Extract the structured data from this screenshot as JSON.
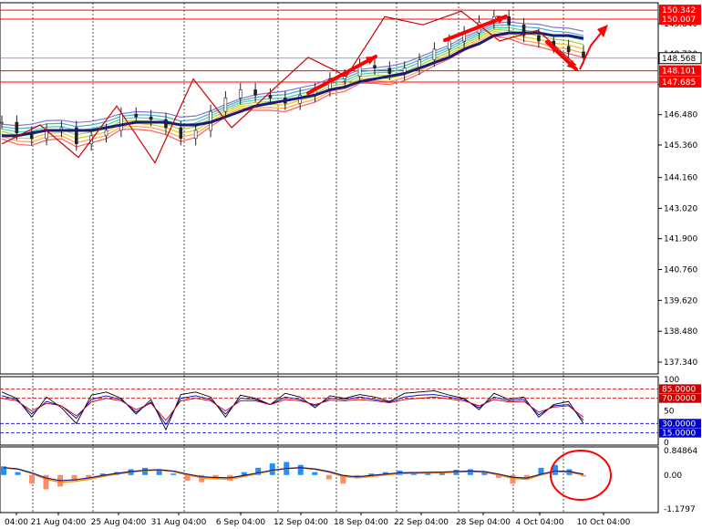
{
  "chart_data": [
    {
      "type": "line",
      "title": "",
      "price_axis_ticks": [
        "149.840",
        "148.720",
        "147.600",
        "146.480",
        "145.360",
        "144.160",
        "143.020",
        "141.900",
        "140.760",
        "139.620",
        "138.480",
        "137.340"
      ],
      "price_levels": [
        {
          "value": "150.342",
          "color": "#ff0000",
          "label_style": "box"
        },
        {
          "value": "150.007",
          "color": "#ff0000",
          "label_style": "box"
        },
        {
          "value": "148.568",
          "color": "#000000",
          "label_style": "current"
        },
        {
          "value": "148.101",
          "color": "#ff0000",
          "label_style": "box"
        },
        {
          "value": "147.685",
          "color": "#ff0000",
          "label_style": "box"
        }
      ],
      "x_axis_labels": [
        "04:00",
        "21 Aug 04:00",
        "25 Aug 04:00",
        "31 Aug 04:00",
        "6 Sep 04:00",
        "12 Sep 04:00",
        "18 Sep 04:00",
        "22 Sep 04:00",
        "28 Sep 04:00",
        "4 Oct 04:00",
        "10 Oct 04:00"
      ],
      "zigzag_path": [
        145.4,
        146.1,
        144.9,
        146.8,
        144.7,
        147.8,
        146.0,
        147.3,
        148.6,
        147.9,
        150.1,
        149.8,
        150.3,
        149.2,
        149.6,
        148.3
      ],
      "price_series": [
        146.2,
        145.8,
        145.6,
        145.9,
        146.0,
        145.4,
        145.7,
        145.9,
        146.5,
        146.4,
        146.3,
        146.0,
        145.6,
        145.9,
        146.6,
        147.1,
        147.4,
        147.2,
        147.1,
        146.9,
        147.2,
        147.4,
        147.8,
        147.9,
        148.3,
        148.2,
        148.0,
        148.2,
        148.5,
        148.9,
        149.2,
        149.5,
        149.9,
        150.1,
        149.8,
        149.4,
        149.2,
        149.0,
        148.8,
        148.6
      ],
      "ma_series": [
        145.7,
        145.7,
        145.8,
        145.9,
        145.9,
        145.9,
        145.9,
        146.0,
        146.1,
        146.2,
        146.2,
        146.2,
        146.1,
        146.1,
        146.2,
        146.4,
        146.6,
        146.8,
        146.9,
        147.0,
        147.1,
        147.2,
        147.4,
        147.5,
        147.7,
        147.8,
        147.9,
        148.0,
        148.2,
        148.4,
        148.6,
        148.9,
        149.1,
        149.4,
        149.5,
        149.5,
        149.5,
        149.4,
        149.4,
        149.3
      ],
      "colors": {
        "zigzag": "#cc0000",
        "ma": "#1a1a7a",
        "arrows": "#ff0000",
        "level": "#ff0000"
      }
    },
    {
      "type": "line",
      "title": "",
      "axis_ticks": [
        "100",
        "50",
        "0"
      ],
      "ylim": [
        0,
        100
      ],
      "levels": [
        {
          "value": "85.0000",
          "color": "#cc0000"
        },
        {
          "value": "70.0000",
          "color": "#cc0000"
        },
        {
          "value": "30.0000",
          "color": "#0000cc"
        },
        {
          "value": "15.0000",
          "color": "#0000cc"
        }
      ],
      "series": [
        {
          "values": [
            80,
            70,
            40,
            72,
            55,
            30,
            75,
            80,
            70,
            45,
            68,
            20,
            76,
            80,
            72,
            40,
            75,
            70,
            60,
            78,
            72,
            55,
            74,
            70,
            76,
            72,
            65,
            78,
            80,
            82,
            75,
            70,
            52,
            78,
            68,
            72,
            40,
            60,
            65,
            30
          ]
        },
        {
          "values": [
            74,
            68,
            45,
            65,
            58,
            38,
            68,
            74,
            68,
            48,
            64,
            28,
            70,
            74,
            68,
            45,
            70,
            68,
            60,
            72,
            68,
            58,
            70,
            68,
            72,
            68,
            64,
            72,
            75,
            76,
            72,
            68,
            55,
            72,
            66,
            68,
            44,
            58,
            60,
            35
          ]
        },
        {
          "values": [
            70,
            66,
            50,
            62,
            58,
            42,
            64,
            70,
            66,
            52,
            62,
            35,
            66,
            70,
            66,
            50,
            66,
            66,
            60,
            68,
            66,
            60,
            67,
            66,
            68,
            66,
            63,
            68,
            70,
            72,
            69,
            66,
            58,
            68,
            64,
            65,
            48,
            56,
            58,
            40
          ]
        }
      ],
      "colors": {
        "s1": "#000000",
        "s2": "#0000cc",
        "s3": "#cc0000"
      }
    },
    {
      "type": "bar",
      "title": "",
      "axis_ticks": [
        "0.84864",
        "0.00",
        "-1.1797"
      ],
      "ylim": [
        -1.1797,
        0.84864
      ],
      "histogram": [
        0.3,
        0.1,
        -0.3,
        -0.5,
        -0.4,
        -0.2,
        -0.1,
        0.05,
        0.1,
        0.2,
        0.25,
        0.2,
        0.05,
        -0.2,
        -0.25,
        -0.15,
        -0.2,
        0.1,
        0.25,
        0.4,
        0.45,
        0.35,
        0.1,
        -0.15,
        -0.3,
        -0.1,
        0.05,
        0.1,
        0.15,
        0.08,
        0.1,
        0.12,
        0.18,
        0.2,
        0.1,
        -0.1,
        -0.3,
        -0.15,
        0.25,
        0.35,
        0.2,
        -0.05
      ],
      "signal_line": [
        0.25,
        0.2,
        0.05,
        -0.15,
        -0.25,
        -0.22,
        -0.15,
        -0.05,
        0.03,
        0.1,
        0.15,
        0.17,
        0.12,
        0.0,
        -0.1,
        -0.13,
        -0.14,
        -0.05,
        0.05,
        0.15,
        0.22,
        0.25,
        0.2,
        0.1,
        -0.05,
        -0.1,
        -0.05,
        0.0,
        0.05,
        0.06,
        0.07,
        0.08,
        0.1,
        0.12,
        0.1,
        0.0,
        -0.12,
        -0.15,
        0.0,
        0.12,
        0.1,
        0.0
      ],
      "colors": {
        "positive": "#1e90ff",
        "negative": "#ff8c69",
        "signal": "#ff8c00",
        "circle": "#ff0000"
      }
    }
  ]
}
